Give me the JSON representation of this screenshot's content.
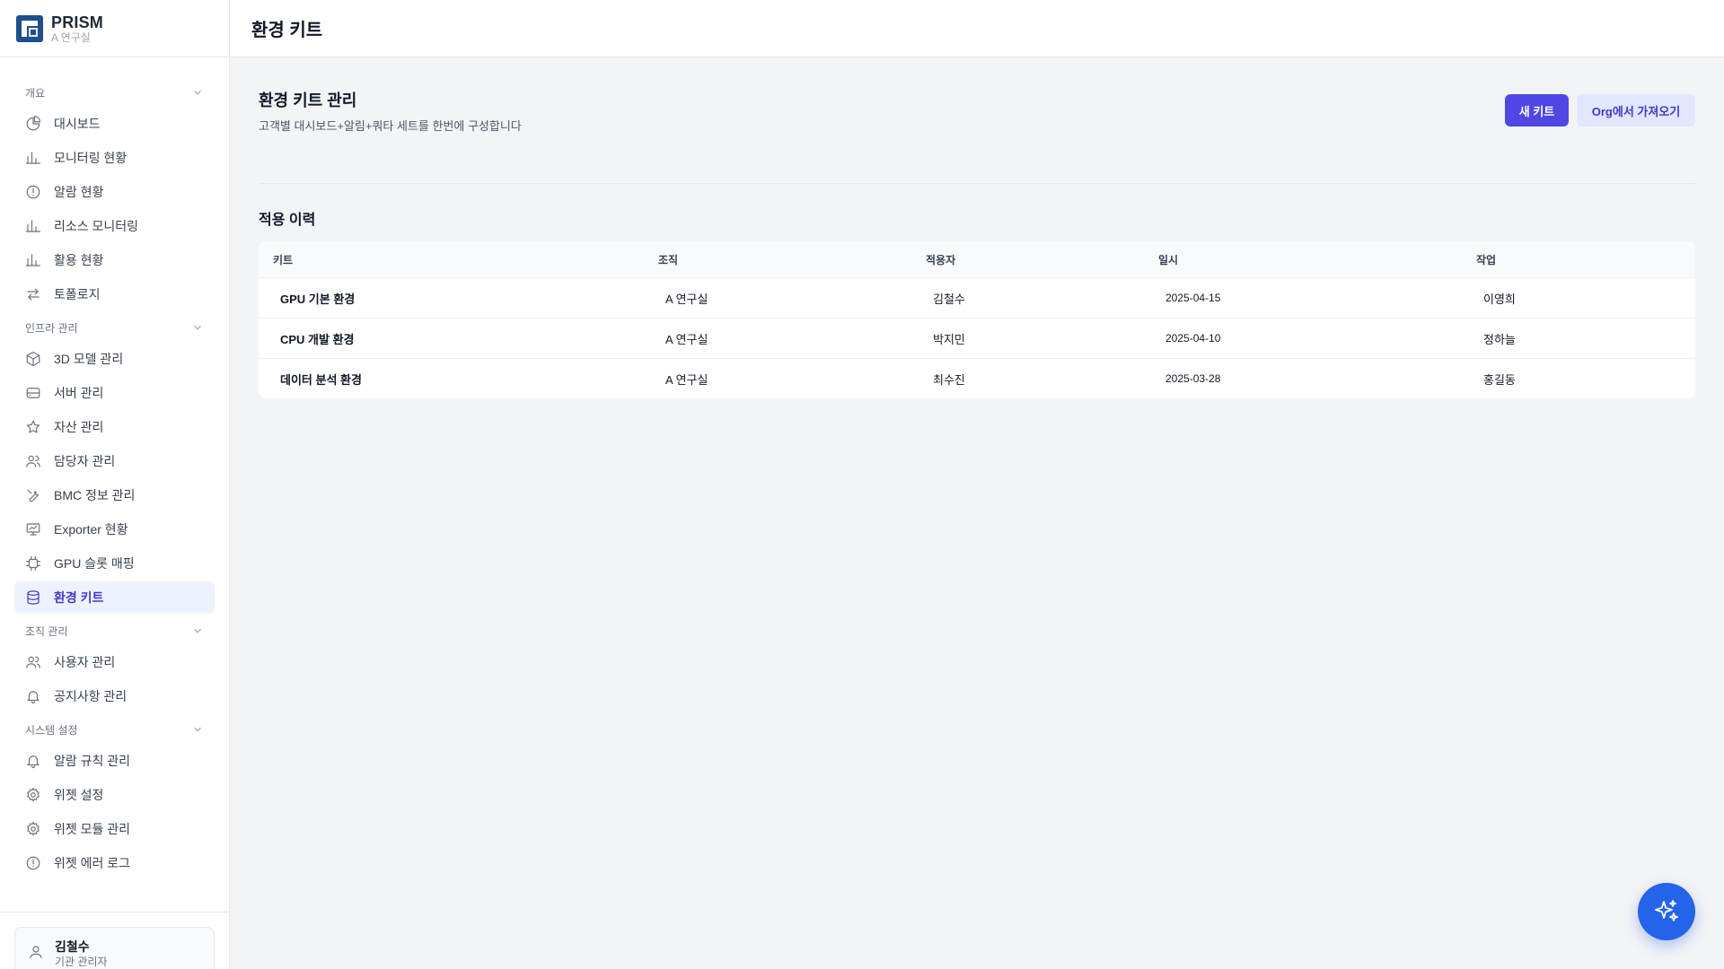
{
  "brand": {
    "name": "PRISM",
    "org": "A 연구실"
  },
  "header": {
    "title": "환경 키트"
  },
  "sidebar": {
    "sections": [
      {
        "label": "개요",
        "items": [
          {
            "label": "대시보드",
            "icon": "pie-chart-icon"
          },
          {
            "label": "모니터링 현황",
            "icon": "bar-chart-icon"
          },
          {
            "label": "알람 현황",
            "icon": "alert-circle-icon"
          },
          {
            "label": "리소스 모니터링",
            "icon": "bar-chart-icon"
          },
          {
            "label": "활용 현황",
            "icon": "bar-chart-icon"
          },
          {
            "label": "토폴로지",
            "icon": "swap-arrows-icon"
          }
        ]
      },
      {
        "label": "인프라 관리",
        "items": [
          {
            "label": "3D 모델 관리",
            "icon": "cube-icon"
          },
          {
            "label": "서버 관리",
            "icon": "server-icon"
          },
          {
            "label": "자산 관리",
            "icon": "star-icon"
          },
          {
            "label": "담당자 관리",
            "icon": "users-icon"
          },
          {
            "label": "BMC 정보 관리",
            "icon": "tools-icon"
          },
          {
            "label": "Exporter 현황",
            "icon": "presentation-icon"
          },
          {
            "label": "GPU 슬롯 매핑",
            "icon": "chip-icon"
          },
          {
            "label": "환경 키트",
            "icon": "database-icon",
            "active": true
          }
        ]
      },
      {
        "label": "조직 관리",
        "items": [
          {
            "label": "사용자 관리",
            "icon": "users-icon"
          },
          {
            "label": "공지사항 관리",
            "icon": "bell-icon"
          }
        ]
      },
      {
        "label": "시스템 설정",
        "items": [
          {
            "label": "알람 규칙 관리",
            "icon": "bell-icon"
          },
          {
            "label": "위젯 설정",
            "icon": "gear-icon"
          },
          {
            "label": "위젯 모듈 관리",
            "icon": "gear-icon"
          },
          {
            "label": "위젯 에러 로그",
            "icon": "alert-circle-icon"
          }
        ]
      }
    ]
  },
  "user": {
    "name": "김철수",
    "role": "기관 관리자"
  },
  "main": {
    "title": "환경 키트 관리",
    "subtitle": "고객별 대시보드+알림+쿼타 세트를 한번에 구성합니다",
    "new_kit_button": "새 키트",
    "import_button": "Org에서 가져오기",
    "history_title": "적용 이력",
    "table": {
      "columns": [
        "키트",
        "조직",
        "적용자",
        "일시",
        "작업"
      ],
      "rows": [
        [
          "GPU 기본 환경",
          "A 연구실",
          "김철수",
          "2025-04-15",
          "이영희"
        ],
        [
          "CPU 개발 환경",
          "A 연구실",
          "박지민",
          "2025-04-10",
          "정하늘"
        ],
        [
          "데이터 분석 환경",
          "A 연구실",
          "최수진",
          "2025-03-28",
          "홍길동"
        ]
      ]
    }
  },
  "colors": {
    "accent": "#4f46e5",
    "active_bg": "#eef2ff",
    "fab": "#2563eb"
  }
}
